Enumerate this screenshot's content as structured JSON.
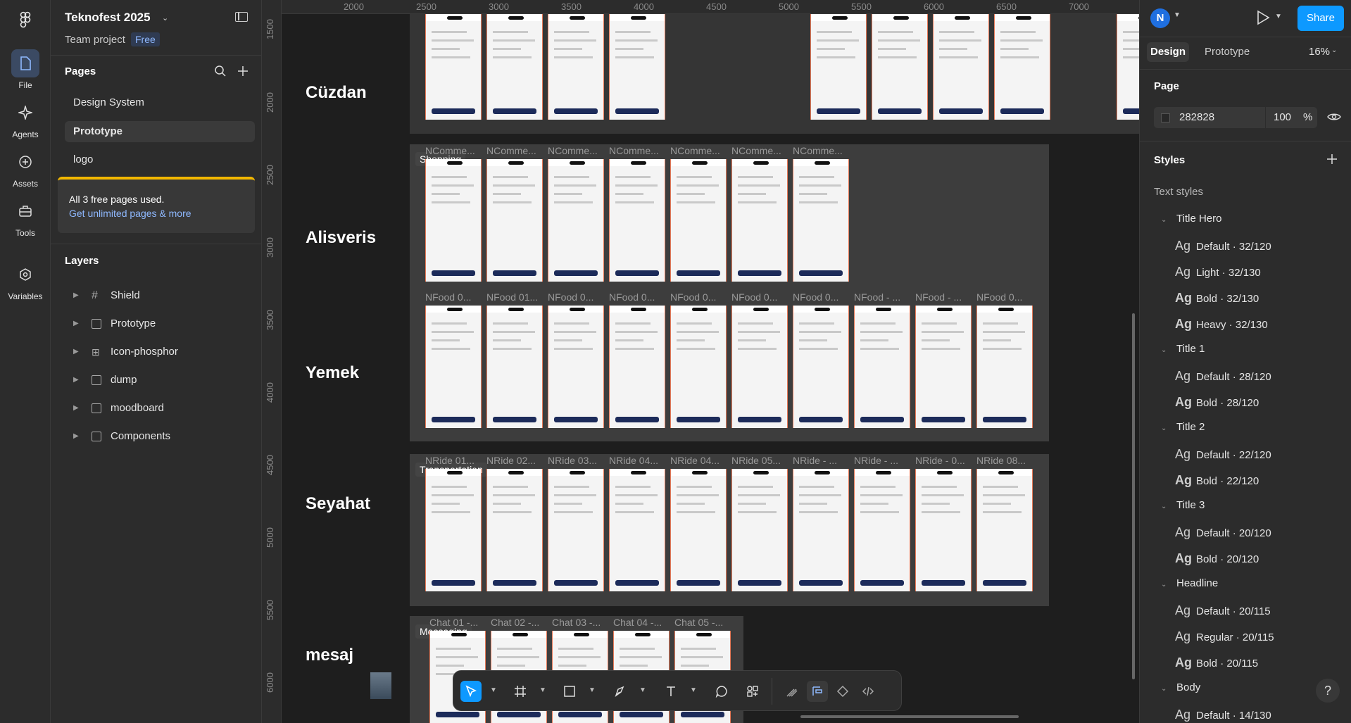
{
  "rail": {
    "items": [
      {
        "label": "File",
        "icon": "file-icon"
      },
      {
        "label": "Agents",
        "icon": "sparkle-icon"
      },
      {
        "label": "Assets",
        "icon": "plus-circle-icon"
      },
      {
        "label": "Tools",
        "icon": "toolbox-icon"
      },
      {
        "label": "Variables",
        "icon": "hexagon-icon"
      }
    ]
  },
  "file": {
    "title": "Teknofest 2025",
    "team": "Team project",
    "plan": "Free"
  },
  "pages": {
    "heading": "Pages",
    "items": [
      "Design System",
      "Prototype",
      "logo"
    ],
    "selected": "Prototype",
    "upsell_text": "All 3 free pages used.",
    "upsell_link": "Get unlimited pages & more"
  },
  "layers": {
    "heading": "Layers",
    "items": [
      "Shield",
      "Prototype",
      "Icon-phosphor",
      "dump",
      "moodboard",
      "Components"
    ]
  },
  "ruler": {
    "top": [
      "2000",
      "2500",
      "3000",
      "3500",
      "4000",
      "4500",
      "5000",
      "5500",
      "6000",
      "6500",
      "7000"
    ],
    "left": [
      "1500",
      "2000",
      "2500",
      "3000",
      "3500",
      "4000",
      "4500",
      "5000",
      "5500",
      "6000"
    ]
  },
  "canvas": {
    "rows": [
      "Cüzdan",
      "Alisveris",
      "Yemek",
      "Seyahat",
      "mesaj"
    ],
    "section_tags": [
      "Shopping",
      "Transportation",
      "Messaging"
    ],
    "shopping_titles": [
      "NComme...",
      "NComme...",
      "NComme...",
      "NComme...",
      "NComme...",
      "NComme...",
      "NComme..."
    ],
    "food_titles": [
      "NFood 0...",
      "NFood 01...",
      "NFood 0...",
      "NFood 0...",
      "NFood 0...",
      "NFood 0...",
      "NFood 0...",
      "NFood - ...",
      "NFood - ...",
      "NFood 0..."
    ],
    "ride_titles": [
      "NRide 01...",
      "NRide 02...",
      "NRide 03...",
      "NRide 04...",
      "NRide 04...",
      "NRide 05...",
      "NRide - ...",
      "NRide - ...",
      "NRide - 0...",
      "NRide 08..."
    ],
    "chat_titles": [
      "Chat 01 -...",
      "Chat 02 -...",
      "Chat 03 -...",
      "Chat 04 -...",
      "Chat 05 -..."
    ]
  },
  "toolbar": {
    "tools": [
      "move-tool",
      "frame-tool",
      "rectangle-tool",
      "pen-tool",
      "text-tool",
      "comment-tool",
      "actions-tool",
      "draw-mode",
      "design-mode",
      "component-mode",
      "dev-mode"
    ]
  },
  "right": {
    "avatar": "N",
    "share": "Share",
    "tabs": [
      "Design",
      "Prototype"
    ],
    "zoom": "16%",
    "page_heading": "Page",
    "page_color": "282828",
    "page_opacity": "100",
    "percent": "%",
    "styles_heading": "Styles",
    "text_styles_heading": "Text styles",
    "groups": [
      {
        "name": "Title Hero",
        "styles": [
          {
            "w": "Default · 32/120",
            "bold": false
          },
          {
            "w": "Light · 32/130",
            "bold": false
          },
          {
            "w": "Bold · 32/130",
            "bold": true
          },
          {
            "w": "Heavy · 32/130",
            "bold": true
          }
        ]
      },
      {
        "name": "Title 1",
        "styles": [
          {
            "w": "Default · 28/120",
            "bold": false
          },
          {
            "w": "Bold · 28/120",
            "bold": true
          }
        ]
      },
      {
        "name": "Title 2",
        "styles": [
          {
            "w": "Default · 22/120",
            "bold": false
          },
          {
            "w": "Bold · 22/120",
            "bold": true
          }
        ]
      },
      {
        "name": "Title 3",
        "styles": [
          {
            "w": "Default · 20/120",
            "bold": false
          },
          {
            "w": "Bold · 20/120",
            "bold": true
          }
        ]
      },
      {
        "name": "Headline",
        "styles": [
          {
            "w": "Default · 20/115",
            "bold": false
          },
          {
            "w": "Regular · 20/115",
            "bold": false
          },
          {
            "w": "Bold · 20/115",
            "bold": true
          }
        ]
      },
      {
        "name": "Body",
        "styles": [
          {
            "w": "Default · 14/130",
            "bold": false
          }
        ]
      }
    ],
    "ag": "Ag",
    "help": "?"
  },
  "colors": {
    "accent": "#0d99ff",
    "navy": "#1c2b5a",
    "frame_border": "#e77b5a"
  }
}
